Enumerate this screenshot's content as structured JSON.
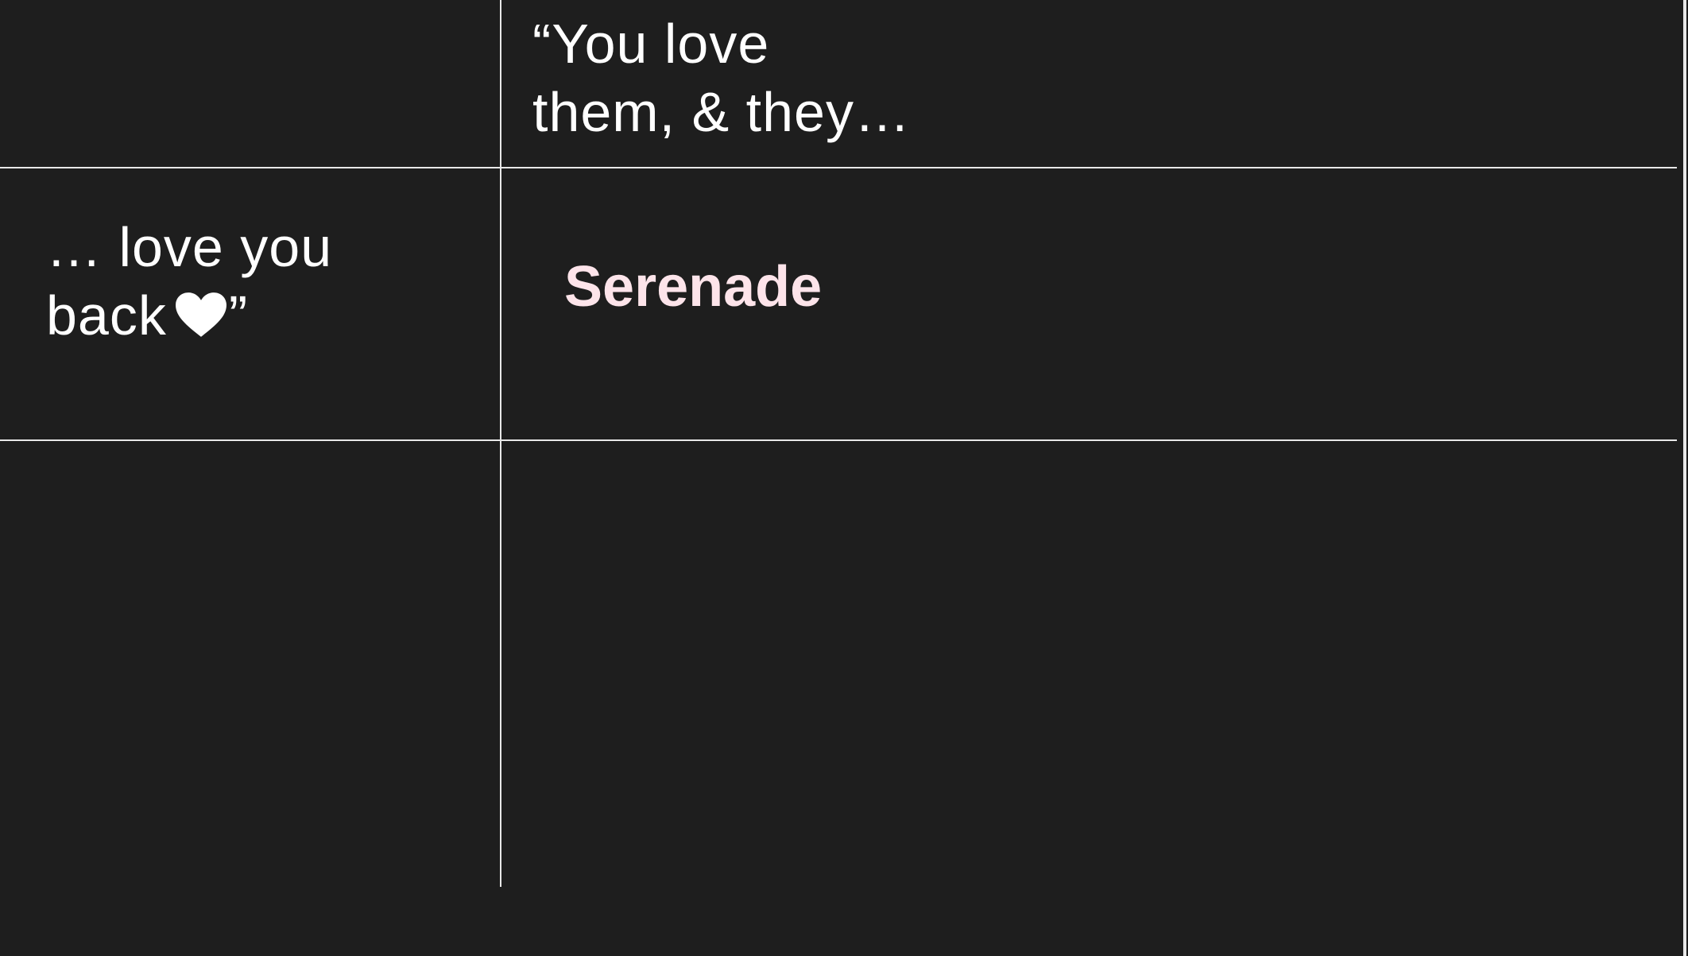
{
  "colors": {
    "background": "#1e1e1e",
    "text": "#ffffff",
    "brand": "#fde4ea",
    "grid_line": "#e8e8e8"
  },
  "quote": {
    "opening_line_1": "“You love",
    "opening_line_2": "them, & they…",
    "closing_line_1": "… love you",
    "closing_line_2_before_icon": "back",
    "closing_line_2_after_icon": "”",
    "icon": "heart-icon"
  },
  "brand": {
    "name": "Serenade"
  }
}
